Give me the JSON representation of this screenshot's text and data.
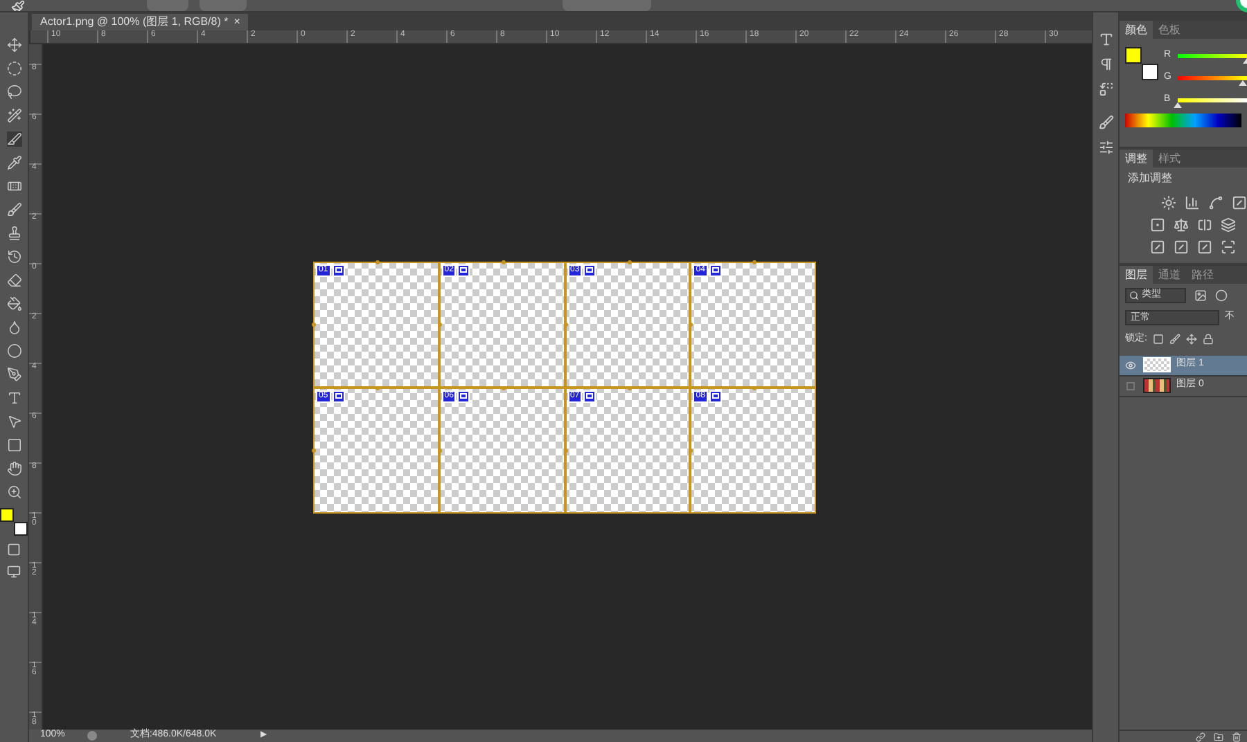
{
  "document_tab": {
    "title": "Actor1.png @ 100% (图层 1, RGB/8) *",
    "close": "×"
  },
  "rulers": {
    "horizontal": [
      "10",
      "8",
      "6",
      "4",
      "2",
      "0",
      "2",
      "4",
      "6",
      "8",
      "10",
      "12",
      "14",
      "16",
      "18",
      "20",
      "22",
      "24",
      "26",
      "28",
      "30"
    ],
    "vertical": [
      "8",
      "6",
      "4",
      "2",
      "0",
      "2",
      "4",
      "6",
      "8",
      "10",
      "12",
      "14",
      "16",
      "18"
    ]
  },
  "canvas": {
    "slices": [
      {
        "number": "01"
      },
      {
        "number": "02"
      },
      {
        "number": "03"
      },
      {
        "number": "04"
      },
      {
        "number": "05"
      },
      {
        "number": "06"
      },
      {
        "number": "07"
      },
      {
        "number": "08"
      }
    ]
  },
  "swatches": [
    {
      "kind": "foreground",
      "color": "#ffff00"
    },
    {
      "kind": "background",
      "color": "#ffffff"
    }
  ],
  "color_panel": {
    "tabs": [
      {
        "label": "颜色",
        "selected": true
      },
      {
        "label": "色板",
        "selected": false
      }
    ],
    "channels": [
      {
        "label": "R",
        "level": 1
      },
      {
        "label": "G",
        "level": 0.93
      },
      {
        "label": "B",
        "level": 0
      }
    ]
  },
  "adjustments_panel": {
    "tabs": [
      {
        "label": "调整",
        "selected": true
      },
      {
        "label": "样式",
        "selected": false
      }
    ],
    "title": "添加调整"
  },
  "layers_panel": {
    "tabs": [
      {
        "label": "图层",
        "selected": true
      },
      {
        "label": "通道",
        "selected": false
      },
      {
        "label": "路径",
        "selected": false
      }
    ],
    "filter": "类型",
    "blend_mode": "正常",
    "opacity_label": "不",
    "lock_label": "锁定:",
    "layers": [
      {
        "name": "图层 1",
        "selected": true,
        "visible": true,
        "kind": "transparent"
      },
      {
        "name": "图层 0",
        "selected": false,
        "visible": false,
        "kind": "image"
      }
    ]
  },
  "status_bar": {
    "zoom": "100%",
    "doc_info": "文档:486.0K/648.0K",
    "arrow": "▶"
  }
}
